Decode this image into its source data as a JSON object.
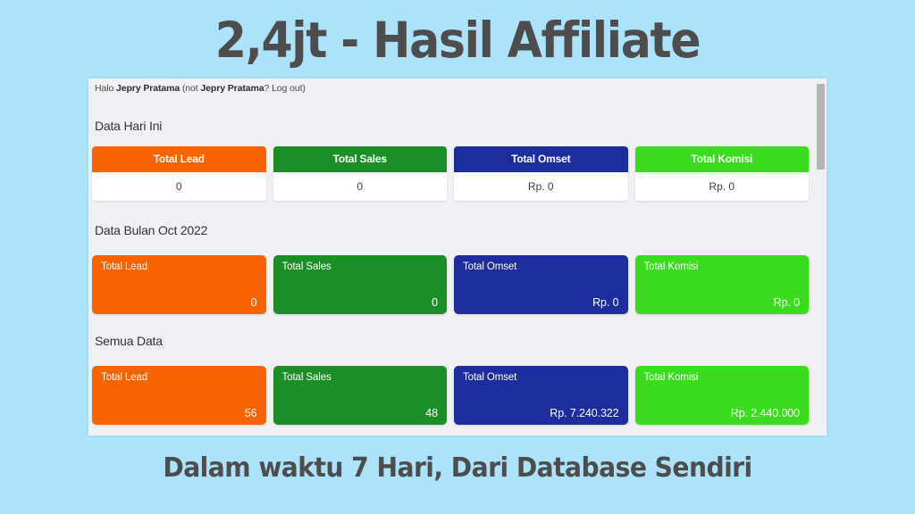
{
  "headline": "2,4jt - Hasil Affiliate",
  "caption": "Dalam waktu 7 Hari, Dari Database Sendiri",
  "colors": {
    "background": "#ade2fb",
    "panel": "#f0f1f4",
    "heading_text": "#4d4d4d",
    "orange": "#fa6400",
    "green": "#1c8e27",
    "navy": "#1e2d9e",
    "bright_green": "#3adc1e"
  },
  "panel": {
    "greeting": {
      "prefix": "Halo ",
      "user": "Jepry Pratama",
      "not_prefix": " (not ",
      "not_user": "Jepry Pratama",
      "question": "? ",
      "logout": "Log out",
      "suffix": ")"
    },
    "sections": [
      {
        "title": "Data Hari Ini",
        "style": "split",
        "cards": [
          {
            "label": "Total Lead",
            "value": "0",
            "color": "#fa6400"
          },
          {
            "label": "Total Sales",
            "value": "0",
            "color": "#1c8e27"
          },
          {
            "label": "Total Omset",
            "value": "Rp. 0",
            "color": "#1e2d9e"
          },
          {
            "label": "Total Komisi",
            "value": "Rp. 0",
            "color": "#3adc1e"
          }
        ]
      },
      {
        "title": "Data Bulan Oct 2022",
        "style": "solid",
        "cards": [
          {
            "label": "Total Lead",
            "value": "0",
            "color": "#fa6400"
          },
          {
            "label": "Total Sales",
            "value": "0",
            "color": "#1c8e27"
          },
          {
            "label": "Total Omset",
            "value": "Rp. 0",
            "color": "#1e2d9e"
          },
          {
            "label": "Total Komisi",
            "value": "Rp. 0",
            "color": "#3adc1e"
          }
        ]
      },
      {
        "title": "Semua Data",
        "style": "solid",
        "cards": [
          {
            "label": "Total Lead",
            "value": "56",
            "color": "#fa6400"
          },
          {
            "label": "Total Sales",
            "value": "48",
            "color": "#1c8e27"
          },
          {
            "label": "Total Omset",
            "value": "Rp. 7.240.322",
            "color": "#1e2d9e"
          },
          {
            "label": "Total Komisi",
            "value": "Rp. 2.440.000",
            "color": "#3adc1e"
          }
        ]
      }
    ]
  }
}
